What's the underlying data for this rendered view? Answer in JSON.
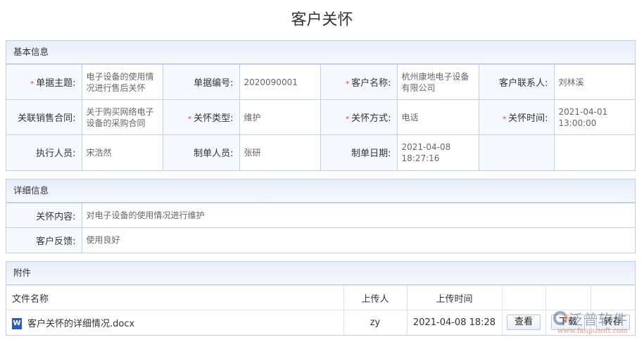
{
  "title": "客户关怀",
  "basic": {
    "header": "基本信息",
    "rows": [
      [
        {
          "label": "单据主题:",
          "required": true,
          "value": "电子设备的使用情况进行售后关怀"
        },
        {
          "label": "单据编号:",
          "required": false,
          "value": "2020090001"
        },
        {
          "label": "客户名称:",
          "required": true,
          "value": "杭州康地电子设备有限公司"
        },
        {
          "label": "客户联系人:",
          "required": false,
          "value": "刘林溪"
        }
      ],
      [
        {
          "label": "关联销售合同:",
          "required": false,
          "value": "关于购买网络电子设备的采购合同"
        },
        {
          "label": "关怀类型:",
          "required": true,
          "value": "维护"
        },
        {
          "label": "关怀方式:",
          "required": true,
          "value": "电话"
        },
        {
          "label": "关怀时间:",
          "required": true,
          "value": "2021-04-01 13:00:00"
        }
      ],
      [
        {
          "label": "执行人员:",
          "required": false,
          "value": "宋浩然"
        },
        {
          "label": "制单人员:",
          "required": false,
          "value": "张研"
        },
        {
          "label": "制单日期:",
          "required": false,
          "value": "2021-04-08 18:27:16"
        }
      ]
    ]
  },
  "detail": {
    "header": "详细信息",
    "rows": [
      {
        "label": "关怀内容:",
        "value": "对电子设备的使用情况进行维护"
      },
      {
        "label": "客户反馈:",
        "value": "使用良好"
      }
    ]
  },
  "attachments": {
    "header": "附件",
    "columns": [
      "文件名称",
      "上传人",
      "上传时间"
    ],
    "rows": [
      {
        "file": "客户关怀的详细情况.docx",
        "uploader": "zy",
        "time": "2021-04-08 18:28",
        "icon": "word-doc-icon",
        "icon_text": "W"
      }
    ],
    "buttons": {
      "view": "查看",
      "download": "下载",
      "save": "转存"
    }
  },
  "watermark": {
    "brand": "泛普软件",
    "url": "www.fanpusoft.com"
  },
  "req_mark": "*"
}
